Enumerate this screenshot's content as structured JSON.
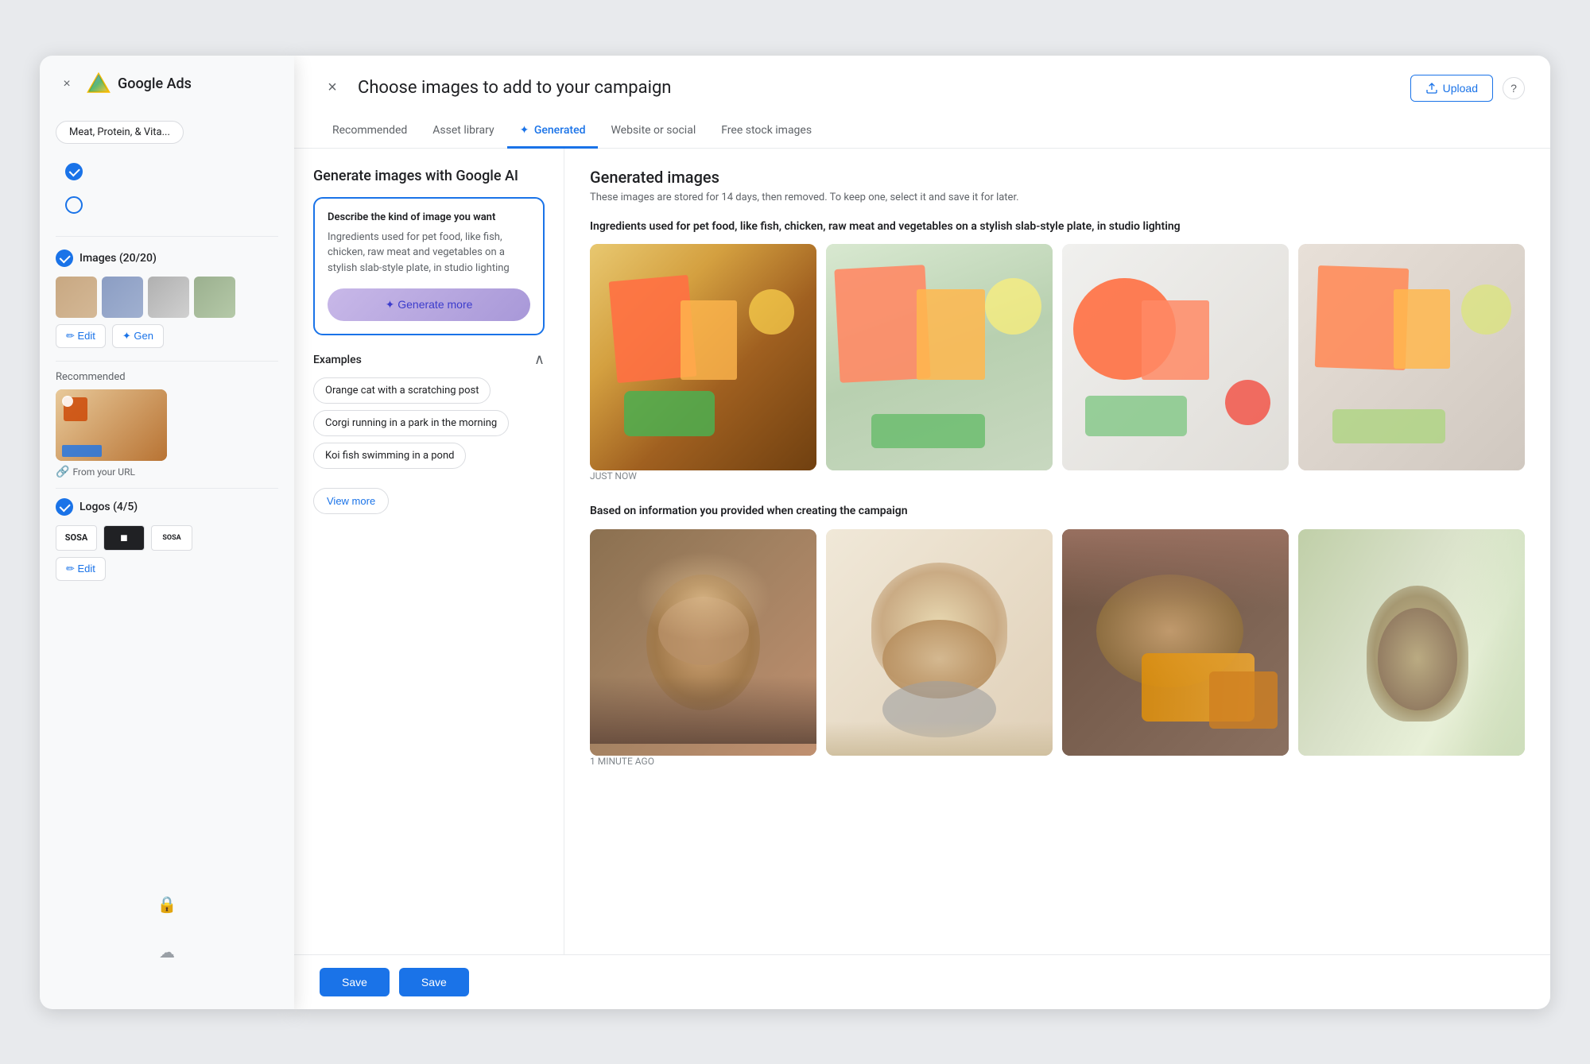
{
  "app": {
    "name": "Google Ads",
    "close_label": "×"
  },
  "sidebar": {
    "close_label": "×",
    "tag": "Meat, Protein, & Vita...",
    "nav_items": [
      {
        "icon": "checked",
        "label": ""
      },
      {
        "icon": "empty",
        "label": ""
      }
    ],
    "images_section": {
      "title": "Images (20/20)",
      "action_edit": "✏ Edit",
      "action_gen": "✦ Gen"
    },
    "recommended_section": {
      "label": "Recommended",
      "from_url_label": "From your URL"
    },
    "logos_section": {
      "title": "Logos (4/5)",
      "edit_label": "✏ Edit"
    }
  },
  "modal": {
    "title": "Choose images to add to your campaign",
    "close_label": "×",
    "help_label": "?",
    "upload_label": "Upload",
    "tabs": [
      {
        "label": "Recommended",
        "active": false
      },
      {
        "label": "Asset library",
        "active": false
      },
      {
        "label": "Generated",
        "active": true,
        "star": true
      },
      {
        "label": "Website or social",
        "active": false
      },
      {
        "label": "Free stock images",
        "active": false
      }
    ],
    "left_panel": {
      "title": "Generate images with Google AI",
      "prompt_label": "Describe the kind of image you want",
      "prompt_text": "Ingredients used for pet food, like fish, chicken, raw meat and vegetables on a stylish slab-style plate, in studio lighting",
      "generate_btn": "✦ Generate more",
      "examples_title": "Examples",
      "examples": [
        "Orange cat with a scratching post",
        "Corgi running in a park in the morning",
        "Koi fish swimming in a pond"
      ],
      "view_more_label": "View more"
    },
    "right_panel": {
      "title": "Generated images",
      "subtitle": "These images are stored for 14 days, then removed. To keep one, select it and save it for later.",
      "groups": [
        {
          "title": "Ingredients used for pet food, like fish, chicken, raw meat and vegetables on a stylish slab-style plate, in studio lighting",
          "timestamp": "JUST NOW",
          "images": [
            "food-img-1",
            "food-img-2",
            "food-img-3",
            "food-img-4"
          ]
        },
        {
          "title": "Based on information you provided when creating the campaign",
          "timestamp": "1 MINUTE AGO",
          "images": [
            "cat-img-1",
            "cat-img-2",
            "cat-img-3",
            "cat-img-4"
          ]
        }
      ]
    },
    "footer": {
      "save_label_1": "Save",
      "save_label_2": "Save"
    }
  }
}
